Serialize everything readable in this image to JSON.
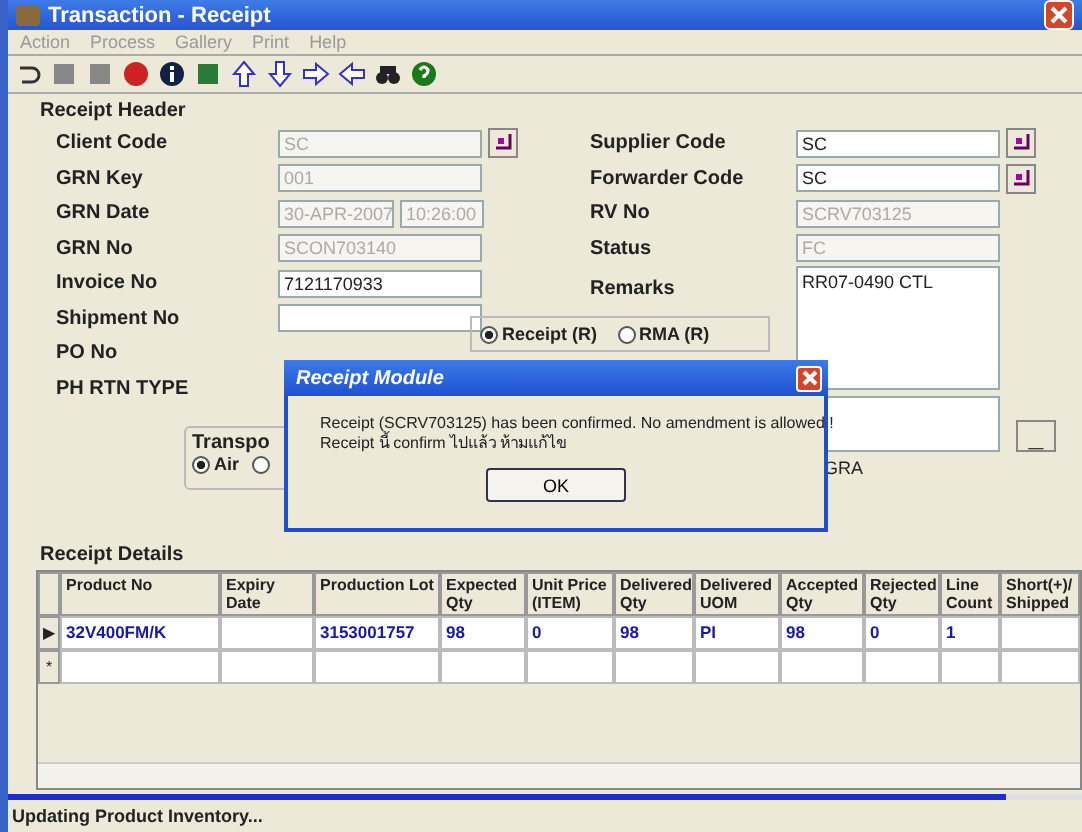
{
  "window": {
    "title": "Transaction - Receipt"
  },
  "menu": [
    "Action",
    "Process",
    "Gallery",
    "Print",
    "Help"
  ],
  "header": {
    "title": "Receipt Header",
    "left": [
      {
        "label": "Client Code",
        "values": [
          {
            "text": "SC",
            "disabled": true
          }
        ],
        "lookup": true
      },
      {
        "label": "GRN Key",
        "values": [
          {
            "text": "001",
            "disabled": true
          }
        ]
      },
      {
        "label": "GRN Date",
        "values": [
          {
            "text": "30-APR-2007",
            "disabled": true
          },
          {
            "text": "10:26:00",
            "disabled": true
          }
        ]
      },
      {
        "label": "GRN No",
        "values": [
          {
            "text": "SCON703140",
            "disabled": true
          }
        ]
      },
      {
        "label": "Invoice No",
        "values": [
          {
            "text": "7121170933",
            "disabled": false
          }
        ]
      },
      {
        "label": "Shipment No",
        "values": [
          {
            "disabled": false
          }
        ]
      },
      {
        "label": "PO No"
      },
      {
        "label": "PH RTN TYPE"
      }
    ],
    "right": [
      {
        "label": "Supplier Code",
        "value": "SC",
        "disabled": false,
        "lookup": true
      },
      {
        "label": "Forwarder Code",
        "value": "SC",
        "disabled": false,
        "lookup": true
      },
      {
        "label": "RV No",
        "value": "SCRV703125",
        "disabled": true
      },
      {
        "label": "Status",
        "value": "FC",
        "disabled": true
      }
    ],
    "remarks_label": "Remarks",
    "remarks": "RR07-0490  CTL",
    "receipt_type": [
      {
        "label": "Receipt (R)",
        "selected": true
      },
      {
        "label": "RMA (R)",
        "selected": false
      }
    ],
    "transport_label": "Transpo",
    "transport": [
      {
        "label": "Air",
        "selected": true
      },
      {
        "selected": false
      }
    ],
    "gra": "GRA",
    "minus_button": "_"
  },
  "dialog": {
    "title": "Receipt Module",
    "lines": [
      "Receipt (SCRV703125) has been confirmed. No amendment is allowed !",
      "Receipt นี้ confirm ไปแล้ว ห้ามแก้ไข"
    ],
    "ok": "OK"
  },
  "details": {
    "title": "Receipt Details",
    "columns": [
      "Product No",
      "Expiry Date",
      "Production Lot",
      "Expected Qty",
      "Unit Price (ITEM)",
      "Delivered Qty",
      "Delivered UOM",
      "Accepted Qty",
      "Rejected Qty",
      "Line Count",
      "Short(+)/ Shipped"
    ],
    "rows": [
      {
        "marker": "▶",
        "cells": [
          "32V400FM/K",
          "",
          "3153001757",
          "98",
          "0",
          "98",
          "PI",
          "98",
          "0",
          "1",
          ""
        ]
      },
      {
        "marker": "*",
        "cells": [
          "",
          "",
          "",
          "",
          "",
          "",
          "",
          "",
          "",
          "",
          ""
        ]
      }
    ]
  },
  "status_bar": {
    "text": "Updating Product Inventory...",
    "level": 0.93
  }
}
